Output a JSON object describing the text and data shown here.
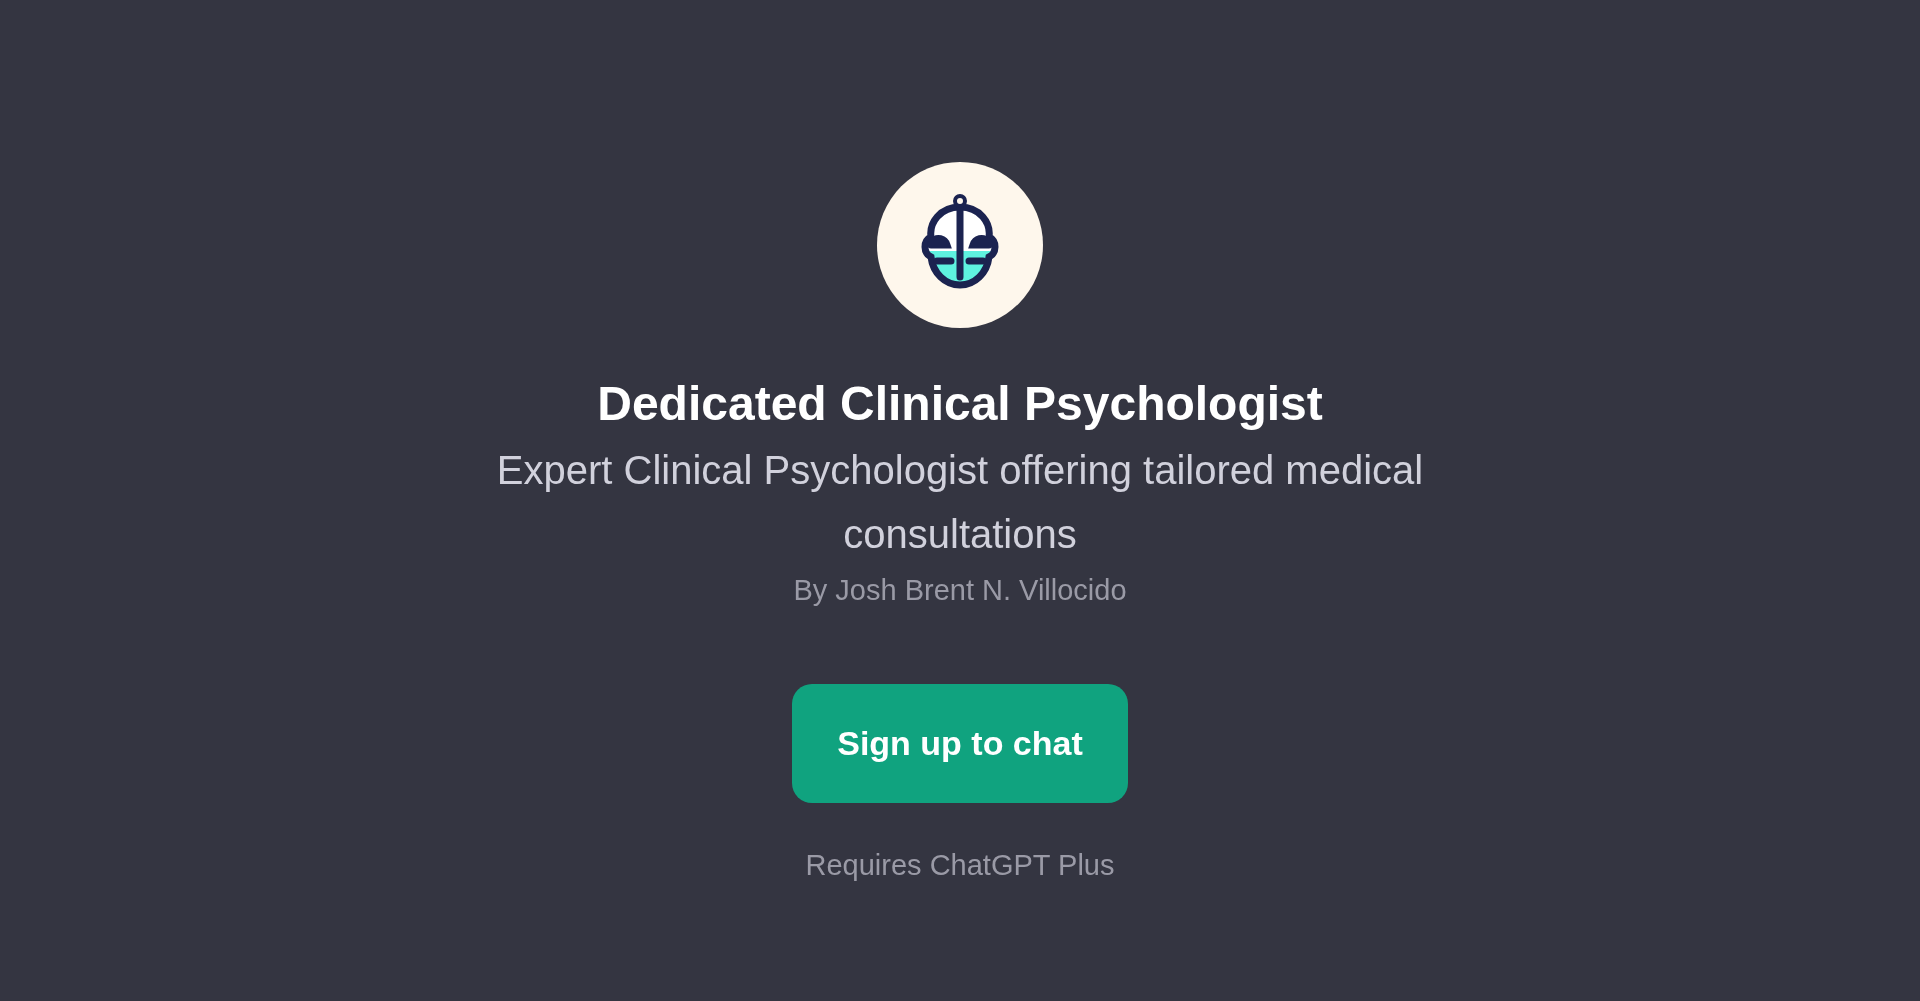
{
  "title": "Dedicated Clinical Psychologist",
  "description": "Expert Clinical Psychologist offering tailored medical consultations",
  "author": "By Josh Brent N. Villocido",
  "button": "Sign up to chat",
  "requirement": "Requires ChatGPT Plus"
}
